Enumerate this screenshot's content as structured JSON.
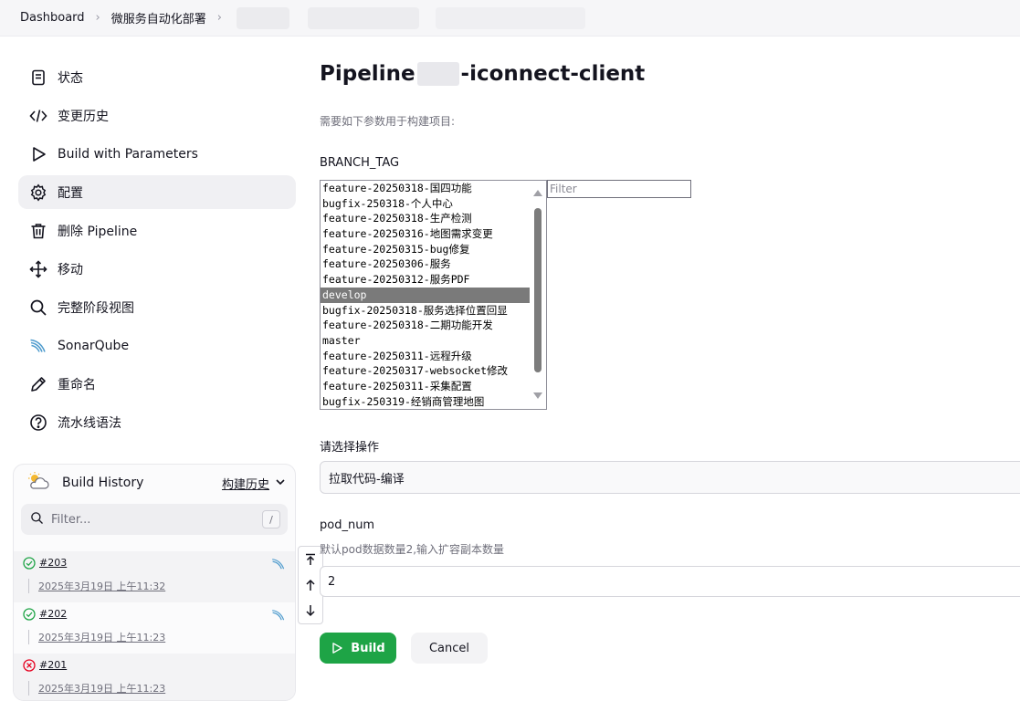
{
  "breadcrumb": {
    "items": [
      "Dashboard",
      "微服务自动化部署"
    ]
  },
  "sidebar": {
    "items": [
      {
        "label": "状态",
        "icon": "document-icon"
      },
      {
        "label": "变更历史",
        "icon": "code-icon"
      },
      {
        "label": "Build with Parameters",
        "icon": "play-icon"
      },
      {
        "label": "配置",
        "icon": "gear-icon",
        "active": true
      },
      {
        "label": "删除 Pipeline",
        "icon": "trash-icon"
      },
      {
        "label": "移动",
        "icon": "move-icon"
      },
      {
        "label": "完整阶段视图",
        "icon": "search-icon"
      },
      {
        "label": "SonarQube",
        "icon": "sonarqube-icon"
      },
      {
        "label": "重命名",
        "icon": "pencil-icon"
      },
      {
        "label": "流水线语法",
        "icon": "help-icon"
      }
    ]
  },
  "history": {
    "title": "Build History",
    "link": "构建历史",
    "search_placeholder": "Filter...",
    "shortcut": "/",
    "builds": [
      {
        "number": "#203",
        "date": "2025年3月19日 上午11:32",
        "status": "success"
      },
      {
        "number": "#202",
        "date": "2025年3月19日 上午11:23",
        "status": "success"
      },
      {
        "number": "#201",
        "date": "2025年3月19日 上午11:23",
        "status": "failed"
      }
    ]
  },
  "main": {
    "title_prefix": "Pipeline",
    "title_suffix": "-iconnect-client",
    "description": "需要如下参数用于构建项目:",
    "branch": {
      "label": "BRANCH_TAG",
      "options": [
        "feature-20250318-国四功能",
        "bugfix-250318-个人中心",
        "feature-20250318-生产检测",
        "feature-20250316-地图需求变更",
        "feature-20250315-bug修复",
        "feature-20250306-服务",
        "feature-20250312-服务PDF",
        "develop",
        "bugfix-20250318-服务选择位置回显",
        "feature-20250318-二期功能开发",
        "master",
        "feature-20250311-远程升级",
        "feature-20250317-websocket修改",
        "feature-20250311-采集配置",
        "bugfix-250319-经销商管理地图"
      ],
      "selected": "develop",
      "filter_placeholder": "Filter"
    },
    "operation": {
      "label": "请选择操作",
      "value": "拉取代码-编译"
    },
    "pod_num": {
      "label": "pod_num",
      "description": "默认pod数据数量2,输入扩容副本数量",
      "value": "2"
    },
    "build_label": "Build",
    "cancel_label": "Cancel"
  },
  "colors": {
    "build_green": "#1ea446",
    "selected_option": "#7a7a7a",
    "success": "#1ea446",
    "failed": "#e6001f"
  }
}
